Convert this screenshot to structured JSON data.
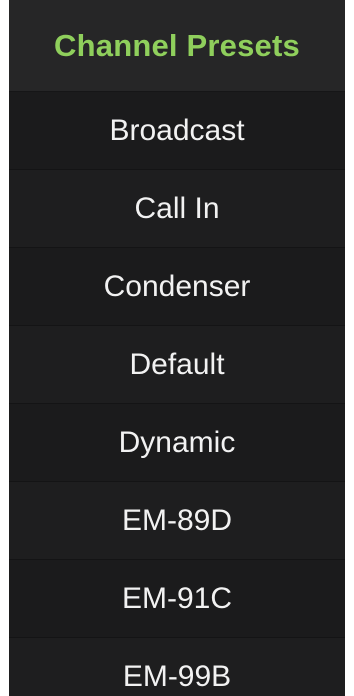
{
  "header": {
    "title": "Channel Presets"
  },
  "presets": [
    {
      "label": "Broadcast"
    },
    {
      "label": "Call In"
    },
    {
      "label": "Condenser"
    },
    {
      "label": "Default"
    },
    {
      "label": "Dynamic"
    },
    {
      "label": "EM-89D"
    },
    {
      "label": "EM-91C"
    },
    {
      "label": "EM-99B"
    }
  ],
  "colors": {
    "title_accent": "#8fcf5c",
    "panel_background": "#1b1b1c",
    "header_background": "#262627",
    "item_text": "#f2f2f2"
  }
}
